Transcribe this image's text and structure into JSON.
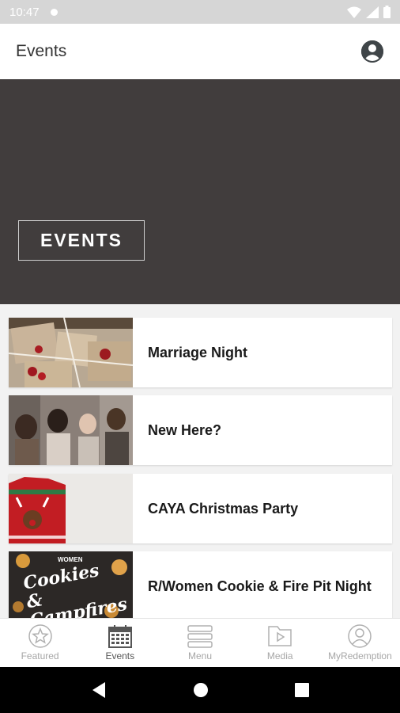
{
  "status": {
    "time": "10:47"
  },
  "appbar": {
    "title": "Events"
  },
  "hero": {
    "badge": "EVENTS"
  },
  "events": [
    {
      "title": "Marriage Night"
    },
    {
      "title": "New Here?"
    },
    {
      "title": "CAYA Christmas Party"
    },
    {
      "title": "R/Women Cookie & Fire Pit Night",
      "thumb_text": "Cookies & Campfires",
      "thumb_small": "WOMEN"
    }
  ],
  "tabs": [
    {
      "label": "Featured",
      "icon": "star-icon"
    },
    {
      "label": "Events",
      "icon": "calendar-icon",
      "active": true
    },
    {
      "label": "Menu",
      "icon": "menu-icon"
    },
    {
      "label": "Media",
      "icon": "media-icon"
    },
    {
      "label": "MyRedemption",
      "icon": "user-icon"
    }
  ],
  "colors": {
    "hero_bg": "#413d3d",
    "status_bg": "#d6d6d6",
    "accent": "#555555"
  }
}
